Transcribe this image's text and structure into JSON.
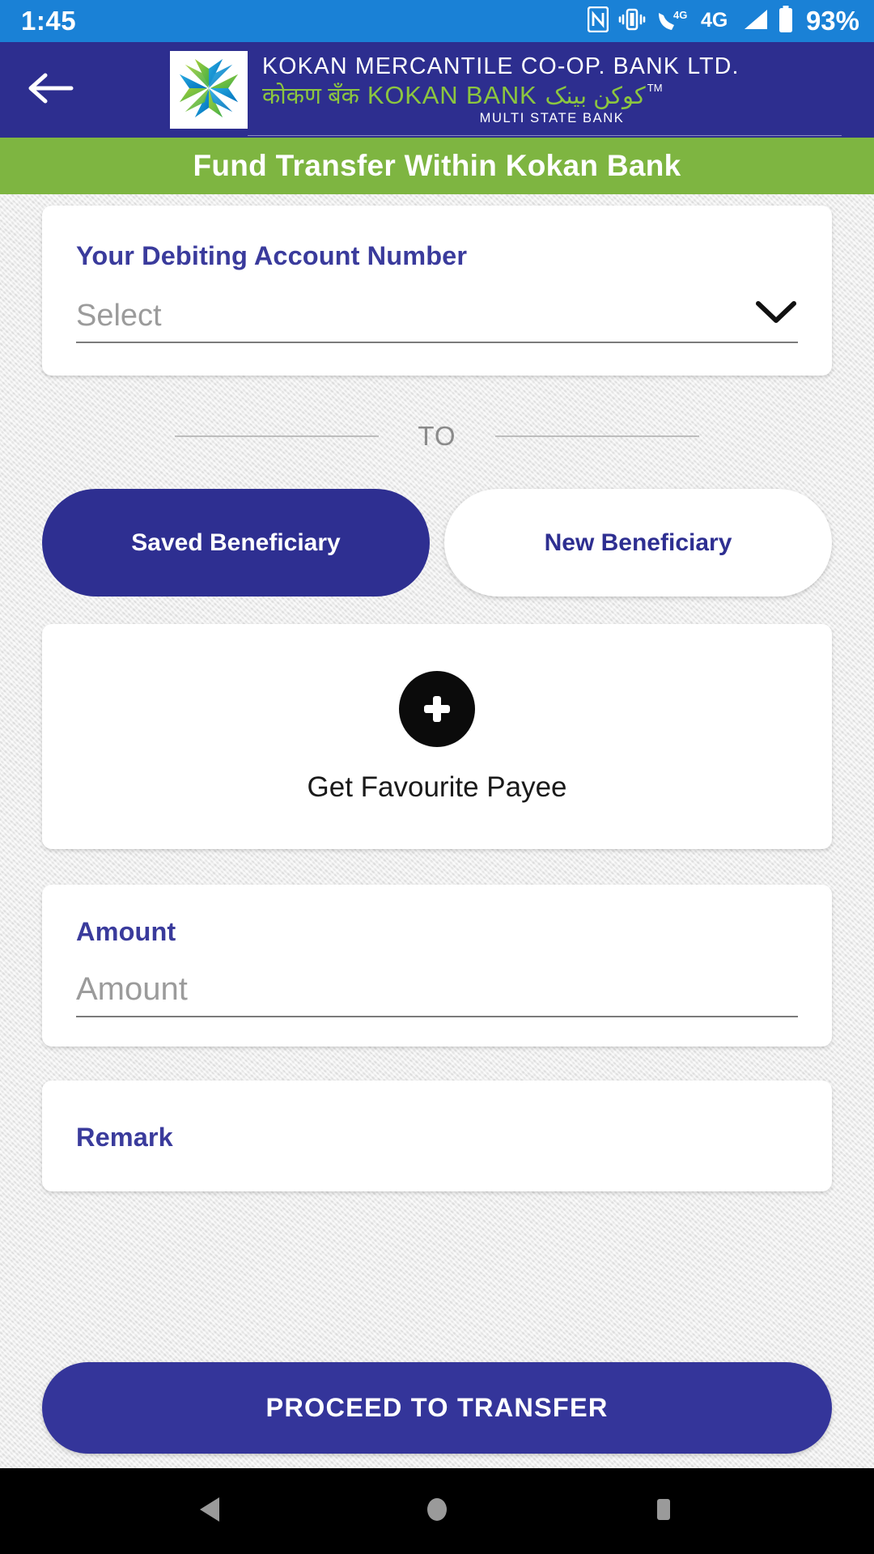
{
  "status_bar": {
    "time": "1:45",
    "battery_percent": "93%",
    "icons": [
      "nfc-icon",
      "vibrate-icon",
      "volte-4g-call-icon",
      "4g-network-icon",
      "signal-bars-icon",
      "battery-icon"
    ]
  },
  "app_bar": {
    "back_icon": "back-arrow-icon",
    "logo_icon": "kokan-bank-star-logo",
    "bank_name_en": "KOKAN  MERCANTILE  CO-OP.  BANK  LTD.",
    "bank_name_devanagari": "कोकण  बँक",
    "bank_name_short": "KOKAN BANK",
    "bank_name_urdu": "کوکن بینک",
    "trademark": "TM",
    "tagline": "MULTI STATE BANK"
  },
  "page": {
    "title": "Fund Transfer Within Kokan Bank"
  },
  "debit_card": {
    "label": "Your Debiting Account Number",
    "select_value": "Select",
    "select_placeholder": "Select",
    "dropdown_icon": "chevron-down-icon"
  },
  "divider": {
    "text": "TO"
  },
  "beneficiary": {
    "saved_label": "Saved Beneficiary",
    "new_label": "New Beneficiary",
    "selected": "Saved Beneficiary"
  },
  "favourite_payee": {
    "icon": "plus-circle-icon",
    "label": "Get Favourite Payee"
  },
  "amount": {
    "label": "Amount",
    "value": "",
    "placeholder": "Amount"
  },
  "remark": {
    "label": "Remark",
    "value": "",
    "placeholder": ""
  },
  "proceed": {
    "label": "PROCEED TO TRANSFER"
  },
  "nav_bar": {
    "back": "nav-back-triangle-icon",
    "home": "nav-home-circle-icon",
    "recents": "nav-recents-square-icon"
  },
  "colors": {
    "status_bar": "#1a81d6",
    "app_bar": "#2d2e8f",
    "accent_green": "#7eb541",
    "indigo": "#2e2f91",
    "logo_green": "#8cc63f",
    "placeholder_grey": "#9b9b9b"
  }
}
